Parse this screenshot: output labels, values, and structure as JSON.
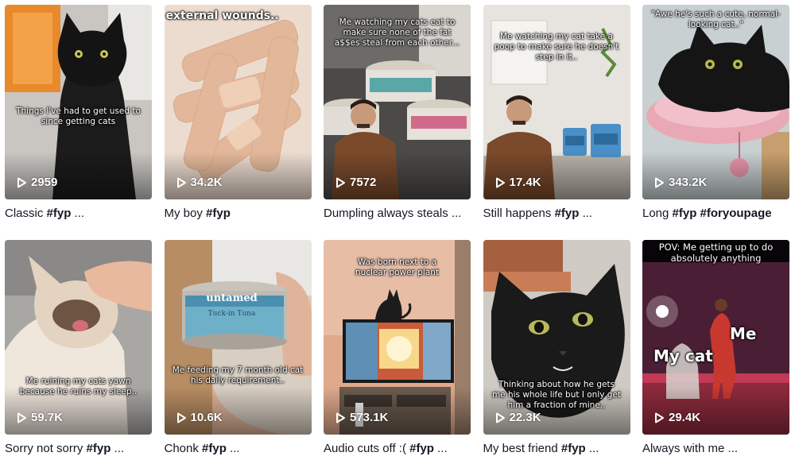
{
  "colors": {
    "caption_text": "#161823",
    "overlay_text": "#ffffff"
  },
  "videos": [
    {
      "views": "2959",
      "caption_text": "Classic ",
      "caption_tags": "#fyp",
      "caption_tail": " ...",
      "overlay": "Things I've had to get used to since getting cats",
      "thumb_icon": "black-cat-thumbnail"
    },
    {
      "views": "34.2K",
      "caption_text": "My boy ",
      "caption_tags": "#fyp",
      "caption_tail": "",
      "overlay": "external wounds..",
      "thumb_icon": "bandages-thumbnail"
    },
    {
      "views": "7572",
      "caption_text": "Dumpling always steals ...",
      "caption_tags": "",
      "caption_tail": "",
      "overlay": "Me watching my cats eat to make sure none of the fat a$$es steal from each other...",
      "thumb_icon": "cat-food-cans-thumbnail"
    },
    {
      "views": "17.4K",
      "caption_text": "Still happens ",
      "caption_tags": "#fyp",
      "caption_tail": " ...",
      "overlay": "Me watching my cat take a poop to make sure he doesn't step in it..",
      "thumb_icon": "litter-box-thumbnail"
    },
    {
      "views": "343.2K",
      "caption_text": "Long ",
      "caption_tags": "#fyp #foryoupage",
      "caption_tail": "",
      "overlay": "\"Awe he's such a cute, normal-looking cat..\"",
      "thumb_icon": "cat-on-pillow-thumbnail"
    },
    {
      "views": "59.7K",
      "caption_text": "Sorry not sorry ",
      "caption_tags": "#fyp",
      "caption_tail": " ...",
      "overlay": "Me ruining my cats yawn because he ruins my sleep..",
      "thumb_icon": "siamese-cat-thumbnail"
    },
    {
      "views": "10.6K",
      "caption_text": "Chonk ",
      "caption_tags": "#fyp",
      "caption_tail": " ...",
      "overlay": "Me feeding my 7 month old cat his daily requirement..",
      "can_brand": "untamed",
      "can_label": "Tuck-in Tuna",
      "thumb_icon": "tuna-can-thumbnail"
    },
    {
      "views": "573.1K",
      "caption_text": "Audio cuts off :( ",
      "caption_tags": "#fyp",
      "caption_tail": " ...",
      "overlay": "Was born next to a nuclear power plant",
      "thumb_icon": "cat-on-tv-thumbnail"
    },
    {
      "views": "22.3K",
      "caption_text": "My best friend ",
      "caption_tags": "#fyp",
      "caption_tail": " ...",
      "overlay": "Thinking about how he gets me his whole life but I only get him a fraction of mine..",
      "thumb_icon": "black-cat-closeup-thumbnail"
    },
    {
      "views": "29.4K",
      "caption_text": "Always with me ...",
      "caption_tags": "",
      "caption_tail": "",
      "overlay": "POV: Me getting up to do absolutely anything",
      "label_a": "My cat",
      "label_b": "Me",
      "thumb_icon": "concert-stage-thumbnail"
    }
  ]
}
